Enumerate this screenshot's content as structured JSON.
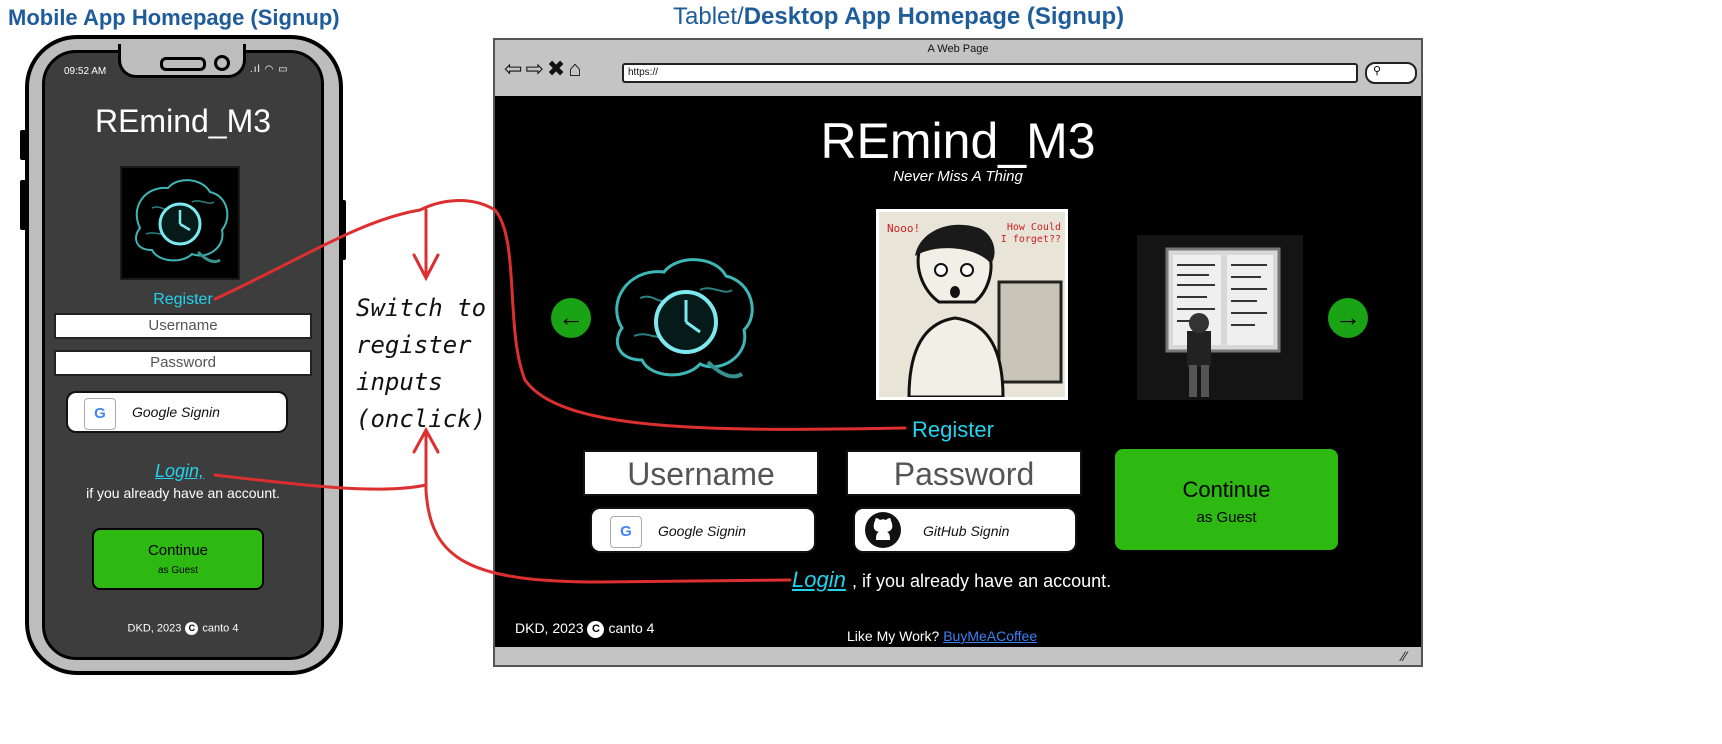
{
  "headers": {
    "mobile": "Mobile App Homepage (Signup)",
    "desktop_prefix": "Tablet/",
    "desktop_bold": "Desktop App Homepage (Signup)"
  },
  "mobile": {
    "time": "09:52 AM",
    "title": "REmind_M3",
    "register": "Register",
    "username_placeholder": "Username",
    "password_placeholder": "Password",
    "google_signin": "Google Signin",
    "login_link": "Login,",
    "already_text": "if you already have an account.",
    "continue_label": "Continue",
    "continue_sub": "as Guest",
    "footer_left": "DKD, 2023",
    "footer_right": "canto 4"
  },
  "browser": {
    "tab_title": "A Web Page",
    "url": "https://"
  },
  "desktop": {
    "title": "REmind_M3",
    "subtitle": "Never Miss A Thing",
    "comic_text_left": "Nooo!",
    "comic_text_right": "How Could I forget??",
    "register": "Register",
    "username_placeholder": "Username",
    "password_placeholder": "Password",
    "google_signin": "Google Signin",
    "github_signin": "GitHub Signin",
    "continue_label": "Continue",
    "continue_sub": "as Guest",
    "login_link": "Login",
    "already_text": ", if you already have an account.",
    "footer_left": "DKD, 2023",
    "footer_right": "canto 4",
    "like_work": "Like My Work?",
    "coffee_link": "BuyMeACoffee"
  },
  "annotation": {
    "lines": [
      "Switch to",
      "register",
      "inputs",
      "(onclick)"
    ]
  },
  "colors": {
    "accent_cyan": "#22d3ee",
    "continue_green": "#2db812",
    "arrow_red": "#dc2f2f",
    "header_blue": "#1f5c99"
  },
  "icons": {
    "google": "google-icon",
    "github": "github-icon",
    "carousel_prev": "arrow-left-icon",
    "carousel_next": "arrow-right-icon"
  }
}
